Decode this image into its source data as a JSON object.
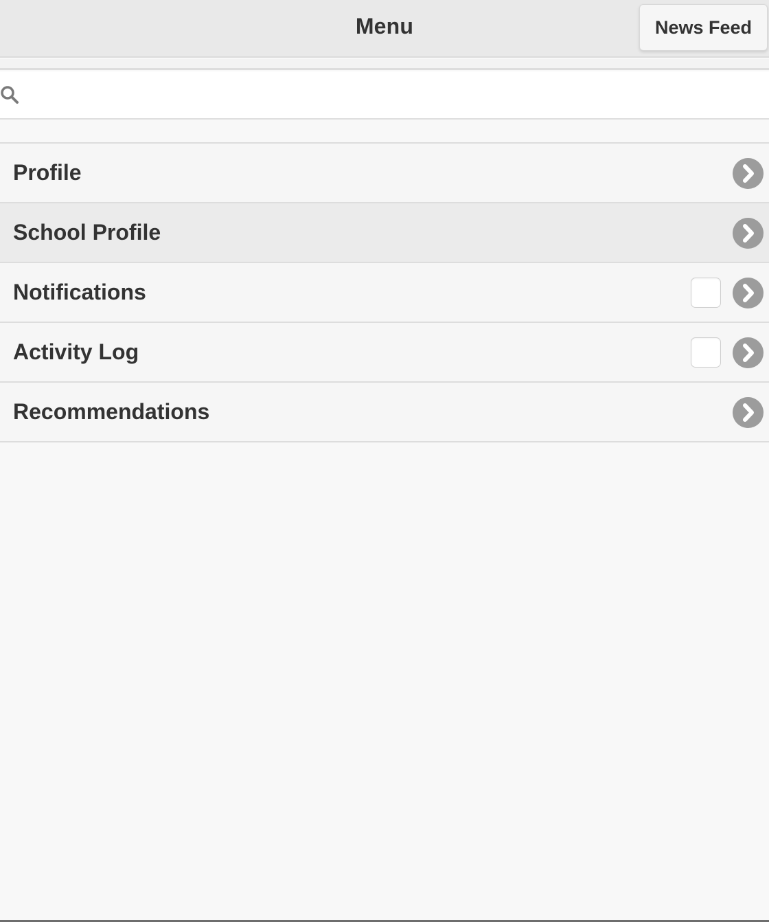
{
  "header": {
    "title": "Menu",
    "news_feed_label": "News Feed"
  },
  "search": {
    "icon": "search-icon",
    "value": "",
    "placeholder": ""
  },
  "menu": {
    "items": [
      {
        "label": "Profile",
        "has_checkbox": false,
        "active": false,
        "icon": "chevron-right-icon"
      },
      {
        "label": "School Profile",
        "has_checkbox": false,
        "active": true,
        "icon": "chevron-right-icon"
      },
      {
        "label": "Notifications",
        "has_checkbox": true,
        "active": false,
        "icon": "chevron-right-icon"
      },
      {
        "label": "Activity Log",
        "has_checkbox": true,
        "active": false,
        "icon": "chevron-right-icon"
      },
      {
        "label": "Recommendations",
        "has_checkbox": false,
        "active": false,
        "icon": "chevron-right-icon"
      }
    ]
  },
  "colors": {
    "header_bg": "#e9e9e9",
    "page_bg": "#f8f8f8",
    "active_row_bg": "#ebebeb",
    "chevron_bg": "#9c9c9c",
    "text": "#333333"
  }
}
